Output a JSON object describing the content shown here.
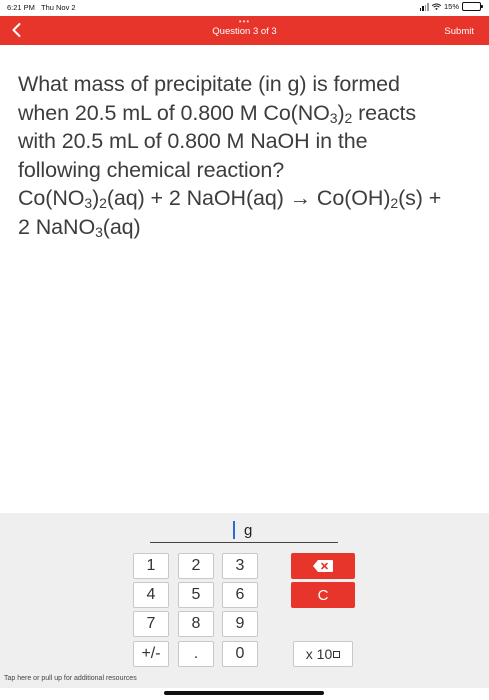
{
  "status": {
    "time": "6:21 PM",
    "date": "Thu Nov 2",
    "battery": "15%",
    "battery_level": 0.15
  },
  "nav": {
    "dots": "•••",
    "title": "Question 3 of 3",
    "submit": "Submit"
  },
  "question": {
    "line1": "What mass of precipitate (in g) is formed",
    "line2_a": "when 20.5 mL of 0.800 M Co(NO",
    "line2_sub3": "3",
    "line2_b": ")",
    "line2_sub2": "2",
    "line2_c": " reacts",
    "line3": "with 20.5 mL of 0.800 M NaOH in the",
    "line4": "following chemical reaction?",
    "line5_a": "Co(NO",
    "line5_sub3": "3",
    "line5_b": ")",
    "line5_sub2": "2",
    "line5_c": "(aq) + 2 NaOH(aq) → Co(OH)",
    "line5_sub2b": "2",
    "line5_d": "(s) +",
    "line6_a": "2 NaNO",
    "line6_sub3": "3",
    "line6_b": "(aq)"
  },
  "answer": {
    "unit": "g"
  },
  "keypad": {
    "k1": "1",
    "k2": "2",
    "k3": "3",
    "k4": "4",
    "k5": "5",
    "k6": "6",
    "k7": "7",
    "k8": "8",
    "k9": "9",
    "sign": "+/-",
    "dot": ".",
    "k0": "0",
    "clear": "C",
    "x10": "x 10"
  },
  "hint": "Tap here or pull up for additional resources",
  "colors": {
    "accent": "#e8352b"
  }
}
